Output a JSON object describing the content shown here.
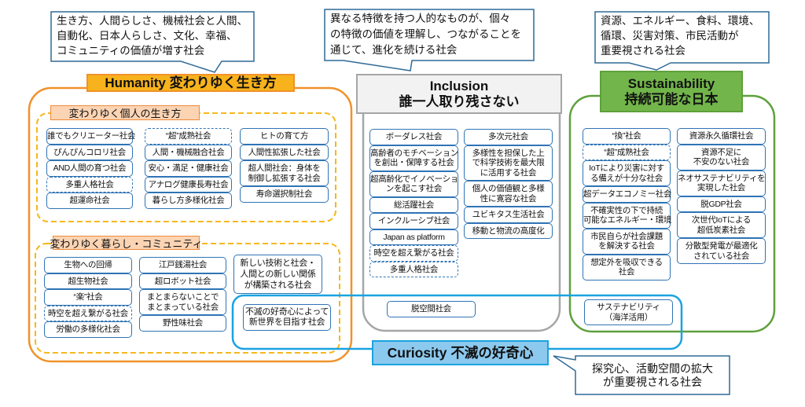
{
  "colors": {
    "humanity_line": "#F0922B",
    "humanity_label": "#F7B21C",
    "humanity_dashed": "#F5B81C",
    "section_label": "#FBD4B4",
    "section_label_border": "#EE8B3D",
    "inclusion_line": "#A6A6A6",
    "inclusion_label": "#F2F2F2",
    "sustainability_line": "#5EA03C",
    "sustainability_label": "#72B54A",
    "curiosity_line": "#1AA3E0",
    "curiosity_label": "#8CC9EE",
    "item_border": "#2F74B5",
    "callout_border": "#2E6A96"
  },
  "humanity": {
    "callout": "生き方、人間らしさ、機械社会と人間、\n自動化、日本人らしさ、文化、幸福、\nコミュニティの価値が増す社会",
    "title": "Humanity 変わりゆく生き方",
    "sections": [
      {
        "title": "変わりゆく個人の生き方",
        "columns": [
          [
            {
              "text": "誰でもクリエーター社会"
            },
            {
              "text": "ぴんぴんコロリ社会"
            },
            {
              "text": "AND人間の育つ社会"
            },
            {
              "text": "多重人格社会",
              "dashed": true
            },
            {
              "text": "超運命社会"
            }
          ],
          [
            {
              "text": "“超”成熟社会",
              "dashed": true
            },
            {
              "text": "人間・機械融合社会"
            },
            {
              "text": "安心・満足・健康社会"
            },
            {
              "text": "アナログ健康長寿社会"
            },
            {
              "text": "暮らし方多様化社会"
            }
          ],
          [
            {
              "text": "ヒトの育て方"
            },
            {
              "text": "人間性拡張した社会"
            },
            {
              "text": "超人間社会：身体を\n制御し拡張する社会"
            },
            {
              "text": "寿命選択制社会"
            }
          ]
        ]
      },
      {
        "title": "変わりゆく暮らし・コミュニティ",
        "columns": [
          [
            {
              "text": "生物への回帰"
            },
            {
              "text": "超生物社会"
            },
            {
              "text": "“楽”社会"
            },
            {
              "text": "時空を超え繋がる社会",
              "dashed": true
            },
            {
              "text": "労働の多様化社会"
            }
          ],
          [
            {
              "text": "江戸銭湯社会"
            },
            {
              "text": "超ロボット社会"
            },
            {
              "text": "まとまらないことで\nまとまっている社会"
            },
            {
              "text": "野性味社会"
            }
          ],
          [
            {
              "text": "新しい技術と社会・\n人間との新しい関係\nが構築される社会"
            }
          ]
        ]
      }
    ]
  },
  "inclusion": {
    "callout": "異なる特徴を持つ人的なものが、個々\nの特徴の価値を理解し、つながることを\n通じて、進化を続ける社会",
    "title": "Inclusion\n誰一人取り残さない",
    "columns": [
      [
        {
          "text": "ボーダレス社会"
        },
        {
          "text": "高齢者のモチベーション\nを創出・保障する社会"
        },
        {
          "text": "超高齢化でイノベーショ\nンを起こす社会"
        },
        {
          "text": "総活躍社会"
        },
        {
          "text": "インクルーシブ社会"
        },
        {
          "text": "Japan as platform"
        },
        {
          "text": "時空を超え繋がる社会",
          "dashed": true
        },
        {
          "text": "多重人格社会",
          "dashed": true
        }
      ],
      [
        {
          "text": "多次元社会"
        },
        {
          "text": "多様性を担保した上\nで科学技術を最大限\nに活用する社会"
        },
        {
          "text": "個人の価値観と多様\n性に寛容な社会"
        },
        {
          "text": "ユビキタス生活社会"
        },
        {
          "text": "移動と物流の高度化"
        }
      ]
    ]
  },
  "sustainability": {
    "callout": "資源、エネルギー、食料、環境、\n循環、災害対策、市民活動が\n重要視される社会",
    "title": "Sustainability\n持続可能な日本",
    "columns": [
      [
        {
          "text": "“換”社会"
        },
        {
          "text": "“超”成熟社会",
          "dashed": true
        },
        {
          "text": "IoTにより災害に対す\nる備えが十分な社会"
        },
        {
          "text": "超データエコノミー社会"
        },
        {
          "text": "不確実性の下で持続\n可能なエネルギー・環境"
        },
        {
          "text": "市民自らが社会課題\nを解決する社会"
        },
        {
          "text": "想定外を吸収できる\n社会"
        }
      ],
      [
        {
          "text": "資源永久循環社会"
        },
        {
          "text": "資源不足に\n不安のない社会"
        },
        {
          "text": "ネオサステナビリティを\n実現した社会"
        },
        {
          "text": "脱GDP社会"
        },
        {
          "text": "次世代IoTによる\n超低炭素社会"
        },
        {
          "text": "分散型発電が最適化\nされている社会"
        }
      ]
    ]
  },
  "curiosity": {
    "title": "Curiosity 不滅の好奇心",
    "callout": "探究心、活動空間の拡大\nが重要視される社会",
    "items_in_humanity": [
      {
        "text": "不滅の好奇心によって\n新世界を目指す社会"
      }
    ],
    "items_in_inclusion": [
      {
        "text": "脱空間社会"
      }
    ],
    "items_in_sustainability": [
      {
        "text": "サステナビリティ\n（海洋活用）"
      }
    ]
  }
}
